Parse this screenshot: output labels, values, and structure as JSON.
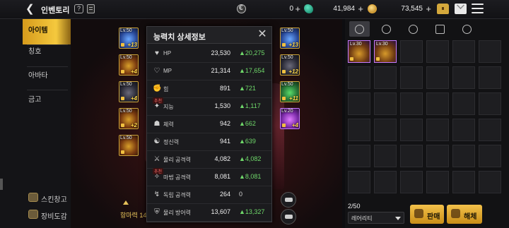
{
  "header": {
    "title": "인벤토리",
    "help_label": "?",
    "currencies": [
      {
        "icon": "euro-coin-icon",
        "value": "0"
      },
      {
        "icon": "green-gem-icon",
        "value": "41,984"
      },
      {
        "icon": "gold-coin-icon",
        "value": "73,545"
      }
    ],
    "plus": "+"
  },
  "nav": {
    "items": [
      "아이템",
      "칭호",
      "아바타",
      "금고"
    ],
    "bottom": [
      "스킨창고",
      "장비도감"
    ]
  },
  "equipment": {
    "left": [
      {
        "level": "Lv.50",
        "enhance": "+13"
      },
      {
        "level": "Lv.50",
        "enhance": "+4"
      },
      {
        "level": "Lv.50",
        "enhance": "+4"
      },
      {
        "level": "Lv.50",
        "enhance": "+2"
      },
      {
        "level": "Lv.50",
        "enhance": ""
      }
    ],
    "right": [
      {
        "level": "Lv.50",
        "enhance": "+13"
      },
      {
        "level": "Lv.50",
        "enhance": "+12"
      },
      {
        "level": "Lv.50",
        "enhance": "+11"
      },
      {
        "level": "Lv.20",
        "enhance": "+4"
      }
    ]
  },
  "combat_power_label": "항마력 14,8",
  "stats_popup": {
    "title": "능력치 상세정보",
    "recommended_tag": "추천",
    "rows": [
      {
        "icon": "heart-icon",
        "label": "HP",
        "value": "23,530",
        "bonus": "▲20,275"
      },
      {
        "icon": "heart-outline-icon",
        "label": "MP",
        "value": "21,314",
        "bonus": "▲17,654"
      },
      {
        "icon": "fist-icon",
        "label": "힘",
        "value": "891",
        "bonus": "▲721"
      },
      {
        "icon": "brain-icon",
        "label": "지능",
        "value": "1,530",
        "bonus": "▲1,117",
        "tag": true
      },
      {
        "icon": "body-icon",
        "label": "체력",
        "value": "942",
        "bonus": "▲662"
      },
      {
        "icon": "spirit-icon",
        "label": "정신력",
        "value": "941",
        "bonus": "▲639"
      },
      {
        "icon": "sword-icon",
        "label": "물리 공격력",
        "value": "4,082",
        "bonus": "▲4,082"
      },
      {
        "icon": "magic-icon",
        "label": "마법 공격력",
        "value": "8,081",
        "bonus": "▲8,081",
        "tag": true
      },
      {
        "icon": "independent-attack-icon",
        "label": "독립 공격력",
        "value": "264",
        "bonus": "0"
      },
      {
        "icon": "shield-icon",
        "label": "물리 방어력",
        "value": "13,607",
        "bonus": "▲13,327"
      }
    ]
  },
  "inventory": {
    "tabs": [
      "equipment-tab-icon",
      "potion-tab-icon",
      "material-tab-icon",
      "card-tab-icon",
      "settings-tab-icon"
    ],
    "items": [
      {
        "level": "Lv.30"
      },
      {
        "level": "Lv.30"
      }
    ],
    "count": "2/50",
    "sort_value": "레어리티",
    "sell_label": "판매",
    "disassemble_label": "해체"
  }
}
